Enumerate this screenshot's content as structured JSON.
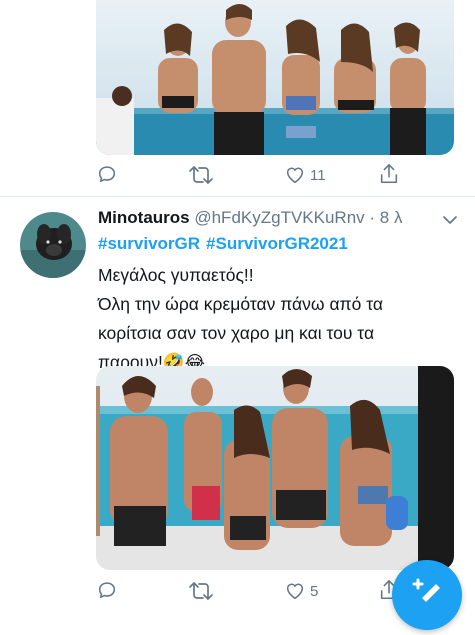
{
  "previous_tweet": {
    "actions": {
      "reply_count": "",
      "retweet_count": "",
      "like_count": "11"
    }
  },
  "tweet": {
    "display_name": "Minotauros",
    "handle": "@hFdKyZgTVKKuRnv",
    "separator": " · ",
    "time_ago": "8 λ",
    "hashtags": [
      "#survivorGR",
      "#SurvivorGR2021"
    ],
    "text_lines": [
      "Μεγάλος γυπαετός!!",
      "Όλη την ώρα κρεμόταν πάνω από τα",
      "κορίτσια σαν τον χαρο μη και του τα",
      "παρουν!"
    ],
    "emojis": "🤣😂",
    "actions": {
      "reply_count": "",
      "retweet_count": "",
      "like_count": "5"
    }
  },
  "colors": {
    "accent": "#1da1f2",
    "icon_gray": "#657786",
    "divider": "#e1e8ed"
  },
  "icons": [
    "reply-icon",
    "retweet-icon",
    "like-icon",
    "share-icon",
    "chevron-down-icon",
    "compose-icon"
  ]
}
